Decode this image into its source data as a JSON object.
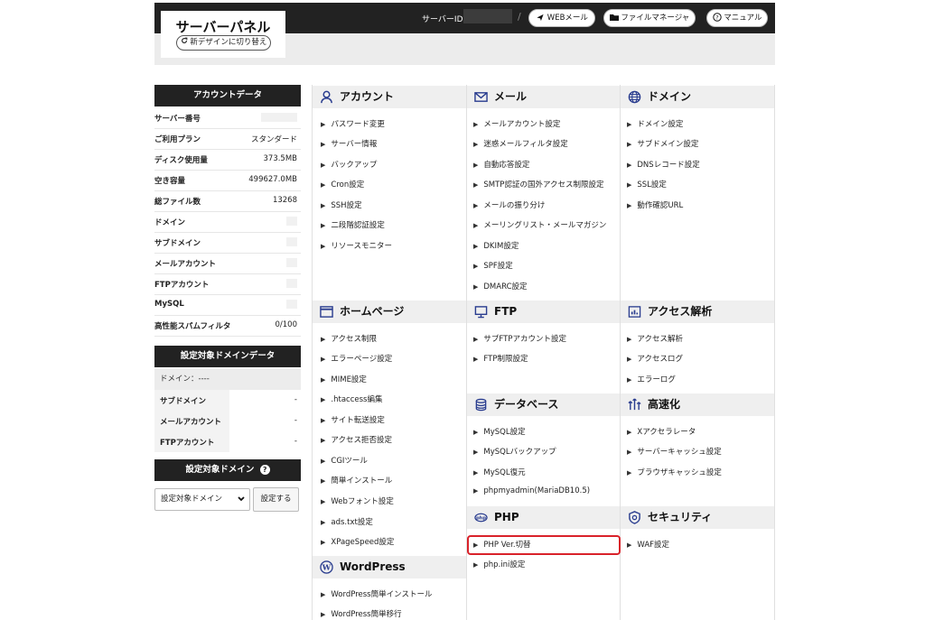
{
  "header": {
    "panel_title": "サーバーパネル",
    "redesign_label": "新デザインに切り替え",
    "server_id_label": "サーバーID",
    "separator": "/",
    "buttons": [
      "WEBメール",
      "ファイルマネージャ",
      "マニュアル"
    ]
  },
  "account": {
    "title": "アカウントデータ",
    "rows": [
      {
        "label": "サーバー番号",
        "value": ""
      },
      {
        "label": "ご利用プラン",
        "value": "スタンダード"
      },
      {
        "label": "ディスク使用量",
        "value": "373.5MB"
      },
      {
        "label": "空き容量",
        "value": "499627.0MB"
      },
      {
        "label": "総ファイル数",
        "value": "13268"
      },
      {
        "label": "ドメイン",
        "value": ""
      },
      {
        "label": "サブドメイン",
        "value": ""
      },
      {
        "label": "メールアカウント",
        "value": ""
      },
      {
        "label": "FTPアカウント",
        "value": ""
      },
      {
        "label": "MySQL",
        "value": ""
      },
      {
        "label": "高性能スパムフィルタ",
        "value": "0/100"
      }
    ]
  },
  "domain_data": {
    "title": "設定対象ドメインデータ",
    "domain_line": "ドメイン：----",
    "rows": [
      {
        "label": "サブドメイン",
        "value": "-"
      },
      {
        "label": "メールアカウント",
        "value": "-"
      },
      {
        "label": "FTPアカウント",
        "value": "-"
      }
    ]
  },
  "target_domain": {
    "title": "設定対象ドメイン",
    "help_icon": "?",
    "select_value": "設定対象ドメイン",
    "button": "設定する"
  },
  "sections": {
    "account": {
      "title": "アカウント",
      "icon": "person-icon",
      "links": [
        "パスワード変更",
        "サーバー情報",
        "バックアップ",
        "Cron設定",
        "SSH設定",
        "二段階認証設定",
        "リソースモニター"
      ]
    },
    "mail": {
      "title": "メール",
      "icon": "mail-icon",
      "links": [
        "メールアカウント設定",
        "迷惑メールフィルタ設定",
        "自動応答設定",
        "SMTP認証の国外アクセス制限設定",
        "メールの振り分け",
        "メーリングリスト・メールマガジン",
        "DKIM設定",
        "SPF設定",
        "DMARC設定"
      ]
    },
    "domain": {
      "title": "ドメイン",
      "icon": "globe-icon",
      "links": [
        "ドメイン設定",
        "サブドメイン設定",
        "DNSレコード設定",
        "SSL設定",
        "動作確認URL"
      ]
    },
    "homepage": {
      "title": "ホームページ",
      "icon": "window-icon",
      "links": [
        "アクセス制限",
        "エラーページ設定",
        "MIME設定",
        ".htaccess編集",
        "サイト転送設定",
        "アクセス拒否設定",
        "CGIツール",
        "簡単インストール",
        "Webフォント設定",
        "ads.txt設定",
        "XPageSpeed設定"
      ]
    },
    "ftp": {
      "title": "FTP",
      "icon": "monitor-icon",
      "links": [
        "サブFTPアカウント設定",
        "FTP制限設定"
      ]
    },
    "analytics": {
      "title": "アクセス解析",
      "icon": "chart-icon",
      "links": [
        "アクセス解析",
        "アクセスログ",
        "エラーログ"
      ]
    },
    "database": {
      "title": "データベース",
      "icon": "database-icon",
      "links": [
        "MySQL設定",
        "MySQLバックアップ",
        "MySQL復元",
        "phpmyadmin(MariaDB10.5)"
      ]
    },
    "speed": {
      "title": "高速化",
      "icon": "speed-icon",
      "links": [
        "Xアクセラレータ",
        "サーバーキャッシュ設定",
        "ブラウザキャッシュ設定"
      ]
    },
    "php": {
      "title": "PHP",
      "icon": "php-icon",
      "links": [
        "PHP Ver.切替",
        "php.ini設定"
      ]
    },
    "security": {
      "title": "セキュリティ",
      "icon": "shield-icon",
      "links": [
        "WAF設定"
      ]
    },
    "wordpress": {
      "title": "WordPress",
      "icon": "wordpress-icon",
      "links": [
        "WordPress簡単インストール",
        "WordPress簡単移行"
      ]
    }
  },
  "highlight_color": "#d9222a"
}
